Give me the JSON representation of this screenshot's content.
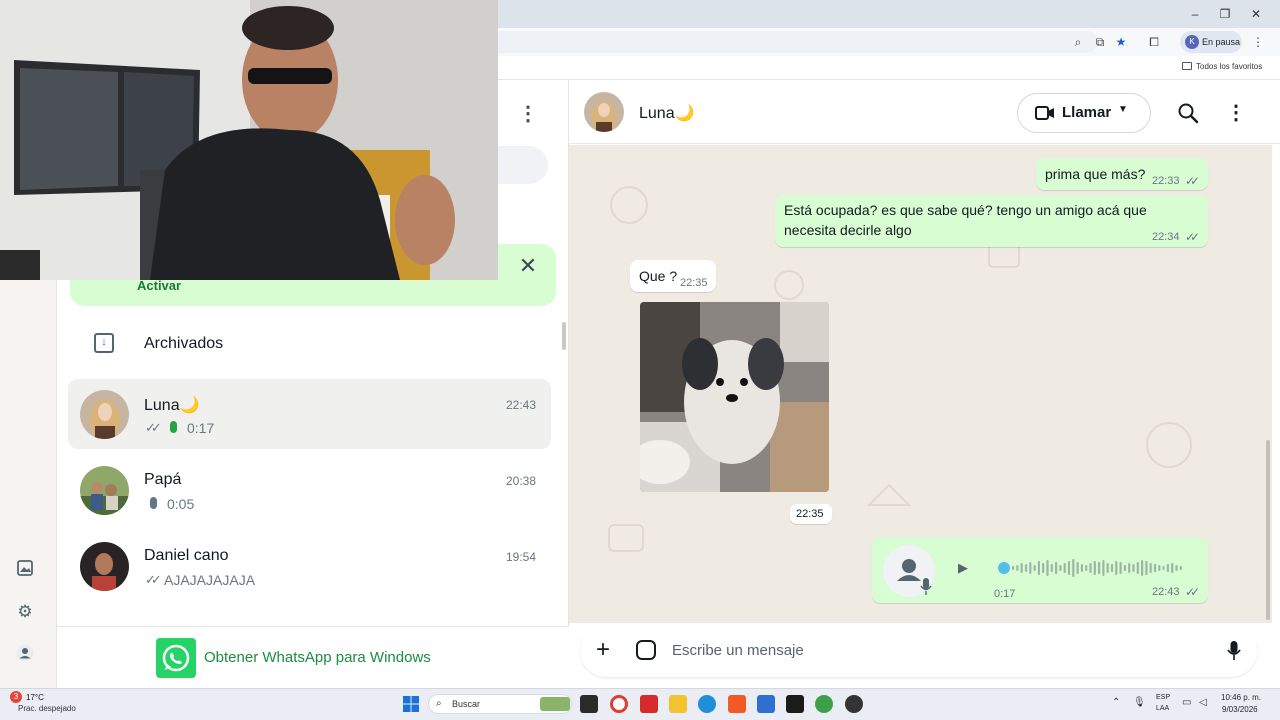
{
  "browser": {
    "profile_label": "En pausa",
    "profile_initial": "K",
    "bookmarks_label": "Todos los favoritos"
  },
  "chat_list": {
    "activate_label": "Activar",
    "archived_label": "Archivados",
    "chats": [
      {
        "name": "Luna🌙",
        "time": "22:43",
        "preview": "0:17"
      },
      {
        "name": "Papá",
        "time": "20:38",
        "preview": "0:05"
      },
      {
        "name": "Daniel cano",
        "time": "19:54",
        "preview": "AJAJAJAJAJA"
      }
    ],
    "get_app_label": "Obtener WhatsApp para Windows"
  },
  "conversation": {
    "contact_name": "Luna🌙",
    "call_label": "Llamar",
    "messages": [
      {
        "text": "prima que más?",
        "time": "22:33"
      },
      {
        "text": "Está ocupada? es que sabe qué? tengo un amigo acá que necesita decirle algo",
        "time": "22:34"
      },
      {
        "text": "Que ?",
        "time": "22:35"
      }
    ],
    "photo_time": "22:35",
    "voice_note": {
      "duration": "0:17",
      "time": "22:43",
      "progress": 0.0
    },
    "composer_placeholder": "Escribe un mensaje"
  },
  "taskbar": {
    "weather_temp": "17°C",
    "weather_desc": "Prac. despejado",
    "weather_badge": "3",
    "search_label": "Buscar",
    "lang_1": "ESP",
    "lang_2": "LAA",
    "time": "10:46 p. m.",
    "date": "9/03/2026"
  },
  "colors": {
    "accent_green": "#25d366",
    "outgoing_bubble": "#d9fdd3",
    "read_ticks": "#53bdeb",
    "chat_bg": "#efeae2"
  }
}
